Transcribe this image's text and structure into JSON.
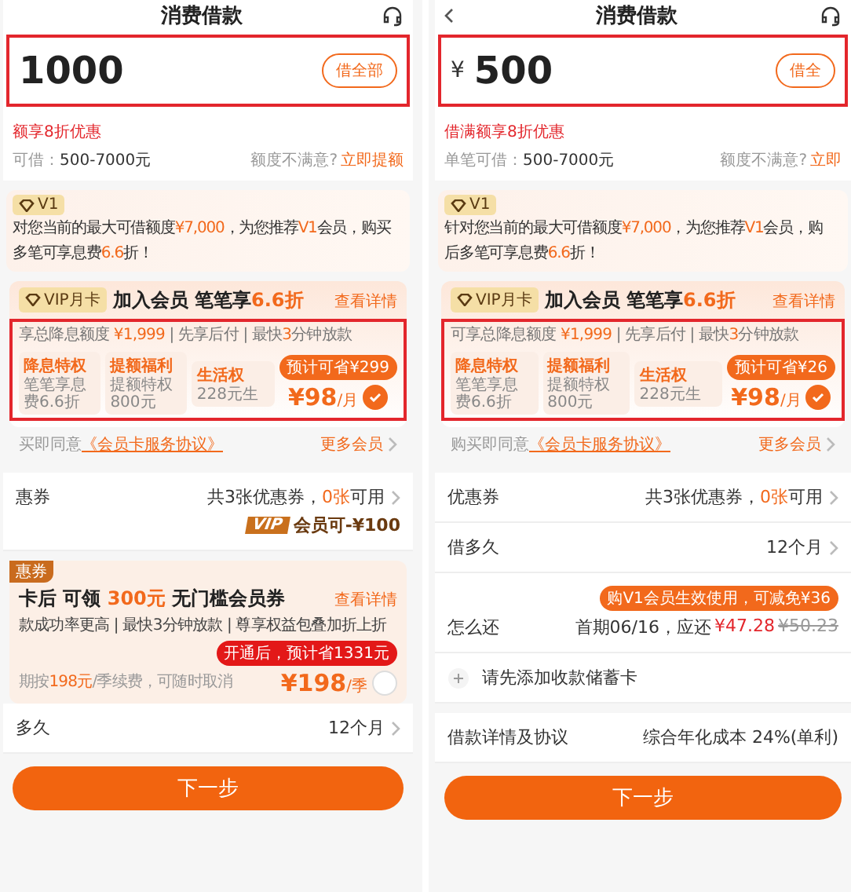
{
  "panels": [
    {
      "title": "消费借款",
      "back": false,
      "sections": [
        {
          "kind": "amount",
          "value": "1000",
          "button": "借全部",
          "highlighted": true
        },
        {
          "kind": "limits",
          "promo": "额享8折优惠",
          "range_label": "可借：",
          "range": "500-7000元",
          "hint": "额度不满意?",
          "link": "立即提额"
        },
        {
          "kind": "v1",
          "tag": "V1",
          "lines": [
            "对您当前的最大可借额度**¥7,000**，为您推荐**V1**会员，购买",
            "多笔可享息费**6.6**折！"
          ]
        },
        {
          "kind": "vip",
          "tag": "VIP月卡",
          "title": "加入会员 笔笔享**6.6折**",
          "link": "查看详情",
          "perks": "享总降息额度 **¥1,999** | 先享后付 | 最快**3**分钟放款",
          "highlighted": true,
          "benefits": [
            {
              "name": "降息特权",
              "note": "笔笔享息费6.6折"
            },
            {
              "name": "提额福利",
              "note": "提额特权800元"
            },
            {
              "name": "生活权",
              "note": "228元生"
            }
          ],
          "badge": "预计可省¥299",
          "price": "¥98",
          "unit": "/月",
          "selected": true,
          "agree": "买即同意",
          "agreement": "《会员卡服务协议》",
          "more": "更多会员"
        },
        {
          "kind": "coupons",
          "label": "惠券",
          "value": "共3张优惠券，**0张**可用",
          "vip_tag": "VIP",
          "vip_note": "会员可-¥100"
        },
        {
          "kind": "member",
          "tag": "惠券",
          "title": "卡后 可领 **300元** 无门槛会员券",
          "link": "查看详情",
          "desc": "款成功率更高 | 最快3分钟放款 | 尊享权益包叠加折上折",
          "renew": "期按**198元**/季续费，可随时取消",
          "badge": "开通后，预计省1331元",
          "price": "¥198",
          "unit": "/季",
          "selected": false
        },
        {
          "kind": "term",
          "label": "多久",
          "value": "12个月"
        },
        {
          "kind": "next",
          "label": "下一步"
        }
      ]
    },
    {
      "title": "消费借款",
      "back": true,
      "sections": [
        {
          "kind": "amount",
          "currency": "¥",
          "value": "500",
          "button": "借全",
          "highlighted": true
        },
        {
          "kind": "limits",
          "promo": "借满额享8折优惠",
          "range_label": "单笔可借：",
          "range": "500-7000元",
          "hint": "额度不满意?",
          "link": "立即"
        },
        {
          "kind": "v1",
          "tag": "V1",
          "lines": [
            "针对您当前的最大可借额度**¥7,000**，为您推荐**V1**会员，购",
            "后多笔可享息费**6.6**折！"
          ]
        },
        {
          "kind": "vip",
          "tag": "VIP月卡",
          "title": "加入会员 笔笔享**6.6折**",
          "link": "查看详情",
          "perks": "可享总降息额度 **¥1,999** | 先享后付 | 最快**3**分钟放款",
          "highlighted": true,
          "benefits": [
            {
              "name": "降息特权",
              "note": "笔笔享息费6.6折"
            },
            {
              "name": "提额福利",
              "note": "提额特权800元"
            },
            {
              "name": "生活权",
              "note": "228元生"
            }
          ],
          "badge": "预计可省¥26",
          "price": "¥98",
          "unit": "/月",
          "selected": true,
          "agree": "购买即同意",
          "agreement": "《会员卡服务协议》",
          "more": "更多会员"
        },
        {
          "kind": "coupons",
          "label": "优惠券",
          "value": "共3张优惠券，**0张**可用"
        },
        {
          "kind": "term",
          "label": "借多久",
          "value": "12个月"
        },
        {
          "kind": "repay",
          "label": "怎么还",
          "badge": "购V1会员生效使用，可减免¥36",
          "lead": "首期06/16，应还",
          "amount": "¥47.28",
          "old": "¥50.23"
        },
        {
          "kind": "addcard",
          "label": "请先添加收款储蓄卡"
        },
        {
          "kind": "cost",
          "label": "借款详情及协议",
          "value": "综合年化成本 **24%(单利)**"
        },
        {
          "kind": "next",
          "label": "下一步"
        }
      ]
    }
  ]
}
